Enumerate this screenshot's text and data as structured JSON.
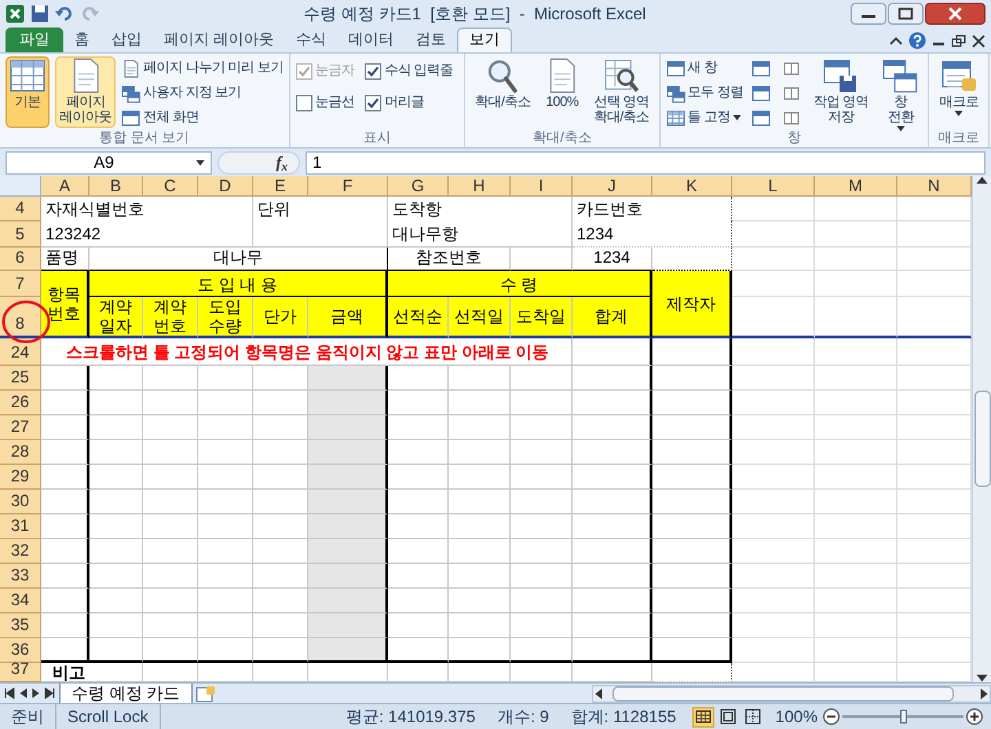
{
  "window": {
    "title": "수령 예정 카드1  [호환 모드]  -  Microsoft Excel"
  },
  "ribbon_tabs": [
    {
      "label": "파일",
      "kind": "file",
      "selected": false
    },
    {
      "label": "홈",
      "kind": "tab",
      "selected": false
    },
    {
      "label": "삽입",
      "kind": "tab",
      "selected": false
    },
    {
      "label": "페이지 레이아웃",
      "kind": "tab",
      "selected": false
    },
    {
      "label": "수식",
      "kind": "tab",
      "selected": false
    },
    {
      "label": "데이터",
      "kind": "tab",
      "selected": false
    },
    {
      "label": "검토",
      "kind": "tab",
      "selected": false
    },
    {
      "label": "보기",
      "kind": "tab",
      "selected": true
    }
  ],
  "ribbon_groups": [
    {
      "label": "통합 문서 보기",
      "items": [
        {
          "kind": "large",
          "label": "기본",
          "selected": true
        },
        {
          "kind": "large",
          "label": "페이지\n레이아웃",
          "hover": true
        },
        {
          "kind": "small",
          "label": "페이지 나누기 미리 보기"
        },
        {
          "kind": "small",
          "label": "사용자 지정 보기"
        },
        {
          "kind": "small",
          "label": "전체 화면"
        }
      ]
    },
    {
      "label": "표시",
      "items": [
        {
          "kind": "check",
          "label": "눈금자",
          "checked": true,
          "disabled": true
        },
        {
          "kind": "check",
          "label": "눈금선",
          "checked": false,
          "disabled": false
        },
        {
          "kind": "check",
          "label": "수식 입력줄",
          "checked": true,
          "disabled": false
        },
        {
          "kind": "check",
          "label": "머리글",
          "checked": true,
          "disabled": false
        }
      ]
    },
    {
      "label": "확대/축소",
      "items": [
        {
          "kind": "large",
          "label": "확대/축소"
        },
        {
          "kind": "large",
          "label": "100%"
        },
        {
          "kind": "large",
          "label": "선택 영역\n확대/축소"
        }
      ]
    },
    {
      "label": "창",
      "items": [
        {
          "kind": "small",
          "label": "새 창"
        },
        {
          "kind": "small",
          "label": "모두 정렬"
        },
        {
          "kind": "small",
          "label": "틀 고정",
          "dropdown": true
        },
        {
          "kind": "icon"
        },
        {
          "kind": "icon"
        },
        {
          "kind": "icon"
        },
        {
          "kind": "icon"
        },
        {
          "kind": "icon"
        },
        {
          "kind": "icon"
        },
        {
          "kind": "large",
          "label": "작업 영역\n저장"
        },
        {
          "kind": "large",
          "label": "창\n전환",
          "dropdown": true
        }
      ]
    },
    {
      "label": "매크로",
      "items": [
        {
          "kind": "large",
          "label": "매크로",
          "dropdown": true
        }
      ]
    }
  ],
  "formula_bar": {
    "name_box": "A9",
    "function_label": "f$_{x}$",
    "value": "1"
  },
  "sheet": {
    "columns": [
      "A",
      "B",
      "C",
      "D",
      "E",
      "F",
      "G",
      "H",
      "I",
      "J",
      "K",
      "L",
      "M",
      "N"
    ],
    "rows": [
      {
        "number": "4",
        "kind": "field",
        "cells": [
          "자재식별번호",
          "",
          "",
          "",
          "단위",
          "",
          "도착항",
          "",
          "",
          "카드번호"
        ]
      },
      {
        "number": "5",
        "kind": "field",
        "cells": [
          "123242",
          "",
          "",
          "",
          "",
          "",
          "대나무항",
          "",
          "",
          "1234"
        ]
      },
      {
        "number": "6",
        "kind": "field",
        "cells": [
          "품명",
          "대나무",
          "",
          "",
          "",
          "",
          "참조번호",
          "",
          "",
          "1234"
        ]
      },
      {
        "number": "7",
        "kind": "header",
        "cells": [
          "항목\n번호",
          "도 입 내 용",
          "",
          "",
          "",
          "",
          "수 령",
          "",
          "",
          "",
          "제작자"
        ]
      },
      {
        "number": "8",
        "kind": "header",
        "cells": [
          "",
          "계약\n일자",
          "계약\n번호",
          "도입\n수량",
          "단가",
          "금액",
          "선적순",
          "선적일",
          "도착일",
          "합계"
        ]
      },
      {
        "number": "24",
        "kind": "note",
        "cells": [
          "스크롤하면 틀 고정되어 항목명은 움직이지 않고 표만 아래로 이동"
        ]
      },
      {
        "number": "25",
        "kind": "body",
        "cells": []
      },
      {
        "number": "26",
        "kind": "body",
        "cells": []
      },
      {
        "number": "27",
        "kind": "body",
        "cells": []
      },
      {
        "number": "28",
        "kind": "body",
        "cells": []
      },
      {
        "number": "29",
        "kind": "body",
        "cells": []
      },
      {
        "number": "30",
        "kind": "body",
        "cells": []
      },
      {
        "number": "31",
        "kind": "body",
        "cells": []
      },
      {
        "number": "32",
        "kind": "body",
        "cells": []
      },
      {
        "number": "33",
        "kind": "body",
        "cells": []
      },
      {
        "number": "34",
        "kind": "body",
        "cells": []
      },
      {
        "number": "35",
        "kind": "body",
        "cells": []
      },
      {
        "number": "36",
        "kind": "body",
        "cells": []
      },
      {
        "number": "37",
        "kind": "label",
        "cells": [
          "비고"
        ]
      }
    ]
  },
  "sheet_tabs": [
    {
      "label": "수령 예정 카드",
      "selected": true
    }
  ],
  "status_bar": {
    "mode": "준비",
    "scroll_lock": "Scroll Lock",
    "average": "평균: 141019.375",
    "count": "개수: 9",
    "sum": "합계: 1128155",
    "views": [
      {
        "selected": true
      },
      {
        "selected": false
      },
      {
        "selected": false
      }
    ],
    "zoom": "100%",
    "zoom_slider": {
      "level": 0.5
    }
  }
}
